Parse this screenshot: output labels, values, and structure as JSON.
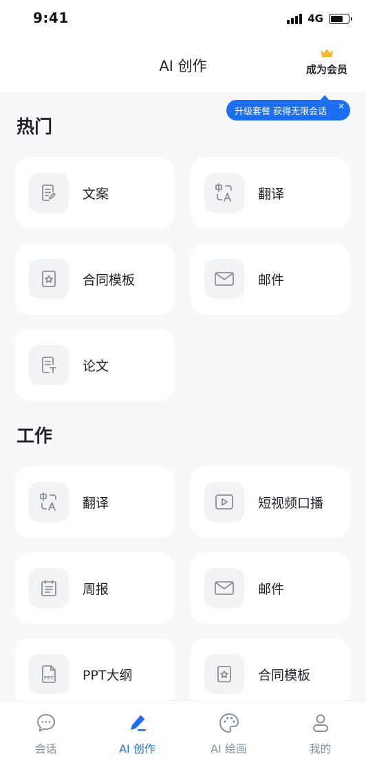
{
  "status_bar": {
    "time": "9:41",
    "network": "4G"
  },
  "header": {
    "title": "AI 创作",
    "vip_label": "成为会员"
  },
  "tooltip": {
    "text": "升级套餐 获得无限会话",
    "close": "×"
  },
  "sections": [
    {
      "title": "热门",
      "items": [
        {
          "label": "文案",
          "icon": "document-edit-icon"
        },
        {
          "label": "翻译",
          "icon": "translate-icon"
        },
        {
          "label": "合同模板",
          "icon": "contract-icon"
        },
        {
          "label": "邮件",
          "icon": "mail-icon"
        },
        {
          "label": "论文",
          "icon": "thesis-icon"
        }
      ]
    },
    {
      "title": "工作",
      "items": [
        {
          "label": "翻译",
          "icon": "translate-icon"
        },
        {
          "label": "短视频口播",
          "icon": "video-play-icon"
        },
        {
          "label": "周报",
          "icon": "calendar-report-icon"
        },
        {
          "label": "邮件",
          "icon": "mail-icon"
        },
        {
          "label": "PPT大纲",
          "icon": "ppt-file-icon"
        },
        {
          "label": "合同模板",
          "icon": "contract-icon"
        }
      ]
    }
  ],
  "bottom_nav": [
    {
      "label": "会话",
      "icon": "chat-bubble-icon",
      "active": false
    },
    {
      "label": "AI 创作",
      "icon": "pen-icon",
      "active": true
    },
    {
      "label": "AI 绘画",
      "icon": "palette-icon",
      "active": false
    },
    {
      "label": "我的",
      "icon": "user-icon",
      "active": false
    }
  ],
  "colors": {
    "accent": "#1E6FF0",
    "crown": "#F5B82E",
    "icon_gray": "#8A9099",
    "background": "#F7F8FA"
  }
}
